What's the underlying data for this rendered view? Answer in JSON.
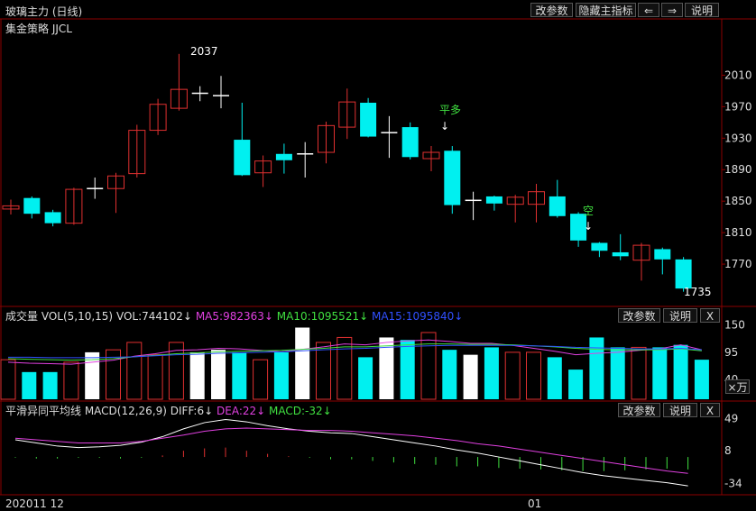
{
  "top_bar": {
    "title": "玻璃主力 (日线)",
    "buttons": [
      "改参数",
      "隐藏主指标",
      "⇐",
      "⇒",
      "说明"
    ]
  },
  "price_panel": {
    "indicator_label": "集金策略 JJCL",
    "y_ticks": [
      "2010",
      "1970",
      "1930",
      "1890",
      "1850",
      "1810",
      "1770"
    ],
    "high_label": "2037",
    "low_label": "1735",
    "signal_labels": [
      "平多",
      "空"
    ]
  },
  "volume_panel": {
    "label_main": "成交量 VOL(5,10,15)",
    "label_vol": "VOL:744102↓",
    "label_ma5": "MA5:982363↓",
    "label_ma10": "MA10:1095521↓",
    "label_ma15": "MA15:1095840↓",
    "buttons": [
      "改参数",
      "说明",
      "X"
    ],
    "y_ticks": [
      "150",
      "95",
      "40"
    ],
    "unit": "×万"
  },
  "macd_panel": {
    "label_main": "平滑异同平均线 MACD(12,26,9)",
    "label_diff": "DIFF:6↓",
    "label_dea": "DEA:22↓",
    "label_macd": "MACD:-32↓",
    "buttons": [
      "改参数",
      "说明",
      "X"
    ],
    "y_ticks": [
      "49",
      "8",
      "-34"
    ]
  },
  "x_axis": {
    "labels": [
      "202011 12",
      "01"
    ]
  },
  "colors": {
    "up": "#e03030",
    "down": "#00f0f0",
    "grid": "#8b0000",
    "ma5": "#e040e0",
    "ma10": "#40e040",
    "ma15": "#3050ff",
    "diff": "#ffffff",
    "dea": "#e040e0"
  },
  "chart_data": {
    "type": "candlestick",
    "price": {
      "ylim": [
        1722,
        2062
      ],
      "candles": [
        {
          "o": 1840,
          "c": 1844,
          "h": 1852,
          "l": 1833
        },
        {
          "o": 1854,
          "c": 1834,
          "h": 1856,
          "l": 1828
        },
        {
          "o": 1836,
          "c": 1822,
          "h": 1839,
          "l": 1818
        },
        {
          "o": 1822,
          "c": 1865,
          "h": 1867,
          "l": 1820
        },
        {
          "o": 1866,
          "c": 1866,
          "h": 1880,
          "l": 1853
        },
        {
          "o": 1866,
          "c": 1882,
          "h": 1886,
          "l": 1835
        },
        {
          "o": 1885,
          "c": 1940,
          "h": 1947,
          "l": 1880
        },
        {
          "o": 1940,
          "c": 1973,
          "h": 1980,
          "l": 1934
        },
        {
          "o": 1968,
          "c": 1992,
          "h": 2037,
          "l": 1965
        },
        {
          "o": 1987,
          "c": 1987,
          "h": 1996,
          "l": 1977
        },
        {
          "o": 1984,
          "c": 1984,
          "h": 2009,
          "l": 1968
        },
        {
          "o": 1928,
          "c": 1883,
          "h": 1975,
          "l": 1882
        },
        {
          "o": 1886,
          "c": 1901,
          "h": 1908,
          "l": 1868
        },
        {
          "o": 1910,
          "c": 1902,
          "h": 1923,
          "l": 1885
        },
        {
          "o": 1910,
          "c": 1910,
          "h": 1925,
          "l": 1880
        },
        {
          "o": 1912,
          "c": 1946,
          "h": 1951,
          "l": 1898
        },
        {
          "o": 1944,
          "c": 1976,
          "h": 1993,
          "l": 1929
        },
        {
          "o": 1975,
          "c": 1932,
          "h": 1981,
          "l": 1931
        },
        {
          "o": 1937,
          "c": 1937,
          "h": 1958,
          "l": 1905
        },
        {
          "o": 1944,
          "c": 1906,
          "h": 1950,
          "l": 1903
        },
        {
          "o": 1904,
          "c": 1912,
          "h": 1920,
          "l": 1888
        },
        {
          "o": 1914,
          "c": 1845,
          "h": 1920,
          "l": 1834
        },
        {
          "o": 1851,
          "c": 1851,
          "h": 1862,
          "l": 1826
        },
        {
          "o": 1856,
          "c": 1847,
          "h": 1857,
          "l": 1838
        },
        {
          "o": 1846,
          "c": 1855,
          "h": 1858,
          "l": 1823
        },
        {
          "o": 1846,
          "c": 1862,
          "h": 1872,
          "l": 1823
        },
        {
          "o": 1856,
          "c": 1831,
          "h": 1877,
          "l": 1829
        },
        {
          "o": 1834,
          "c": 1800,
          "h": 1836,
          "l": 1792
        },
        {
          "o": 1797,
          "c": 1787,
          "h": 1798,
          "l": 1779
        },
        {
          "o": 1785,
          "c": 1780,
          "h": 1808,
          "l": 1775
        },
        {
          "o": 1775,
          "c": 1794,
          "h": 1797,
          "l": 1749
        },
        {
          "o": 1789,
          "c": 1776,
          "h": 1791,
          "l": 1757
        },
        {
          "o": 1776,
          "c": 1739,
          "h": 1779,
          "l": 1735
        }
      ]
    },
    "volume": {
      "ylim": [
        0,
        155
      ],
      "values": [
        80,
        55,
        55,
        75,
        95,
        100,
        115,
        90,
        115,
        95,
        100,
        95,
        80,
        95,
        145,
        115,
        125,
        85,
        125,
        120,
        135,
        100,
        90,
        105,
        95,
        95,
        85,
        60,
        125,
        105,
        105,
        105,
        110,
        80
      ],
      "ma5": [
        75,
        73,
        72,
        71,
        75,
        79,
        87,
        92,
        99,
        100,
        103,
        102,
        99,
        96,
        101,
        106,
        112,
        110,
        115,
        118,
        120,
        117,
        113,
        113,
        109,
        103,
        97,
        90,
        93,
        95,
        99,
        102,
        110,
        100
      ],
      "ma10": [
        82,
        81,
        80,
        79,
        80,
        82,
        86,
        89,
        92,
        94,
        96,
        97,
        98,
        99,
        101,
        103,
        106,
        106,
        108,
        110,
        112,
        112,
        111,
        111,
        110,
        108,
        106,
        103,
        101,
        100,
        100,
        100,
        102,
        98
      ],
      "ma15": [
        85,
        85,
        84,
        84,
        84,
        85,
        86,
        88,
        90,
        91,
        93,
        94,
        95,
        96,
        98,
        100,
        102,
        103,
        105,
        107,
        108,
        109,
        109,
        109,
        109,
        108,
        107,
        105,
        104,
        103,
        102,
        102,
        103,
        100
      ]
    },
    "macd": {
      "ylim": [
        -38,
        52
      ],
      "diff": [
        22,
        18,
        14,
        12,
        13,
        15,
        19,
        26,
        36,
        44,
        48,
        45,
        40,
        36,
        33,
        31,
        30,
        26,
        22,
        18,
        14,
        9,
        5,
        0,
        -5,
        -10,
        -15,
        -20,
        -24,
        -27,
        -30,
        -33,
        -37
      ],
      "dea": [
        24,
        22,
        20,
        18,
        18,
        18,
        20,
        24,
        28,
        33,
        36,
        37,
        36,
        35,
        34,
        34,
        33,
        31,
        29,
        27,
        24,
        21,
        17,
        14,
        10,
        6,
        2,
        -2,
        -6,
        -10,
        -14,
        -18,
        -21
      ],
      "hist": [
        -1,
        -2,
        -2,
        -1,
        -1,
        -2,
        -1,
        2,
        8,
        11,
        12,
        8,
        4,
        1,
        -1,
        -3,
        -3,
        -5,
        -7,
        -9,
        -10,
        -12,
        -12,
        -14,
        -15,
        -16,
        -17,
        -18,
        -18,
        -17,
        -16,
        -15,
        -16
      ]
    }
  }
}
